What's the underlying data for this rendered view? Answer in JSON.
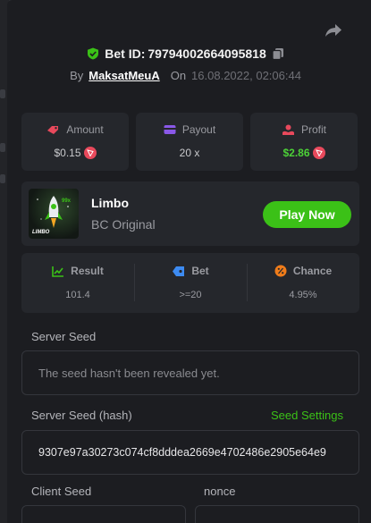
{
  "header": {
    "bet_id_label": "Bet ID:",
    "bet_id": "79794002664095818",
    "by_label": "By",
    "username": "MaksatMeuA",
    "on_label": "On",
    "date": "16.08.2022, 02:06:44"
  },
  "stats": {
    "amount_label": "Amount",
    "amount_value": "$0.15",
    "payout_label": "Payout",
    "payout_value": "20 x",
    "profit_label": "Profit",
    "profit_value": "$2.86"
  },
  "game": {
    "name": "Limbo",
    "subtitle": "BC Original",
    "play_label": "Play Now",
    "thumb_label": "LIMBO"
  },
  "result": {
    "result_label": "Result",
    "result_value": "101.4",
    "bet_label": "Bet",
    "bet_value": ">=20",
    "chance_label": "Chance",
    "chance_value": "4.95%"
  },
  "seeds": {
    "server_seed_label": "Server Seed",
    "server_seed_value": "The seed hasn't been revealed yet.",
    "server_hash_label": "Server Seed (hash)",
    "seed_settings_label": "Seed Settings",
    "server_hash_value": "9307e97a30273c074cf8dddea2669e4702486e2905e64e9",
    "client_seed_label": "Client Seed",
    "nonce_label": "nonce"
  },
  "colors": {
    "accent_green": "#3bc117",
    "profit_green": "#4cd137",
    "coin_red": "#e8495c",
    "panel_bg": "#1c1d21",
    "card_bg": "#25272c"
  }
}
